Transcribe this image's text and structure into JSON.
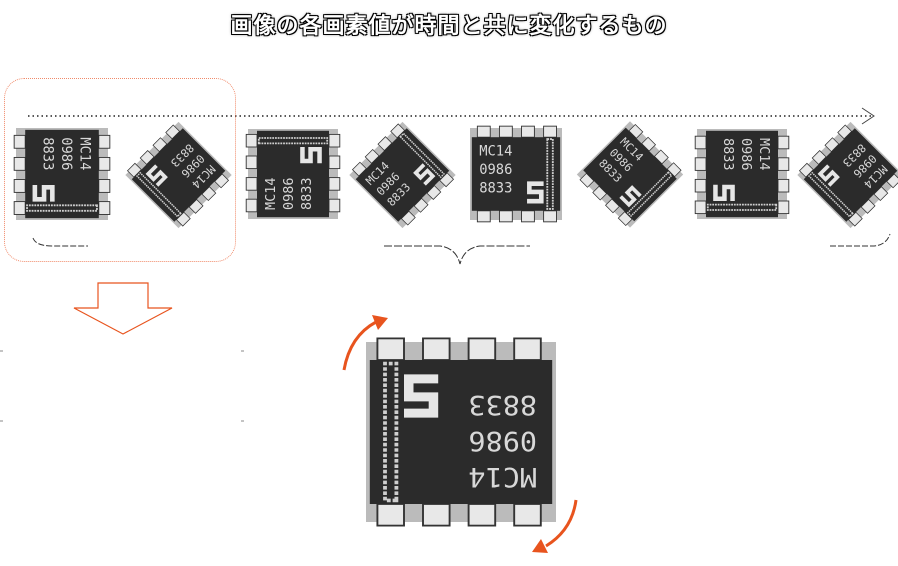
{
  "title": "画像の各画素値が時間と共に変化するもの",
  "chip_label": {
    "line1": "MC14",
    "line2": "0986",
    "line3": "8833",
    "logo": "S"
  },
  "colors": {
    "accent_orange": "#e8541e",
    "box_border": "#f08a6a",
    "chip_body": "#2a2a2a"
  }
}
